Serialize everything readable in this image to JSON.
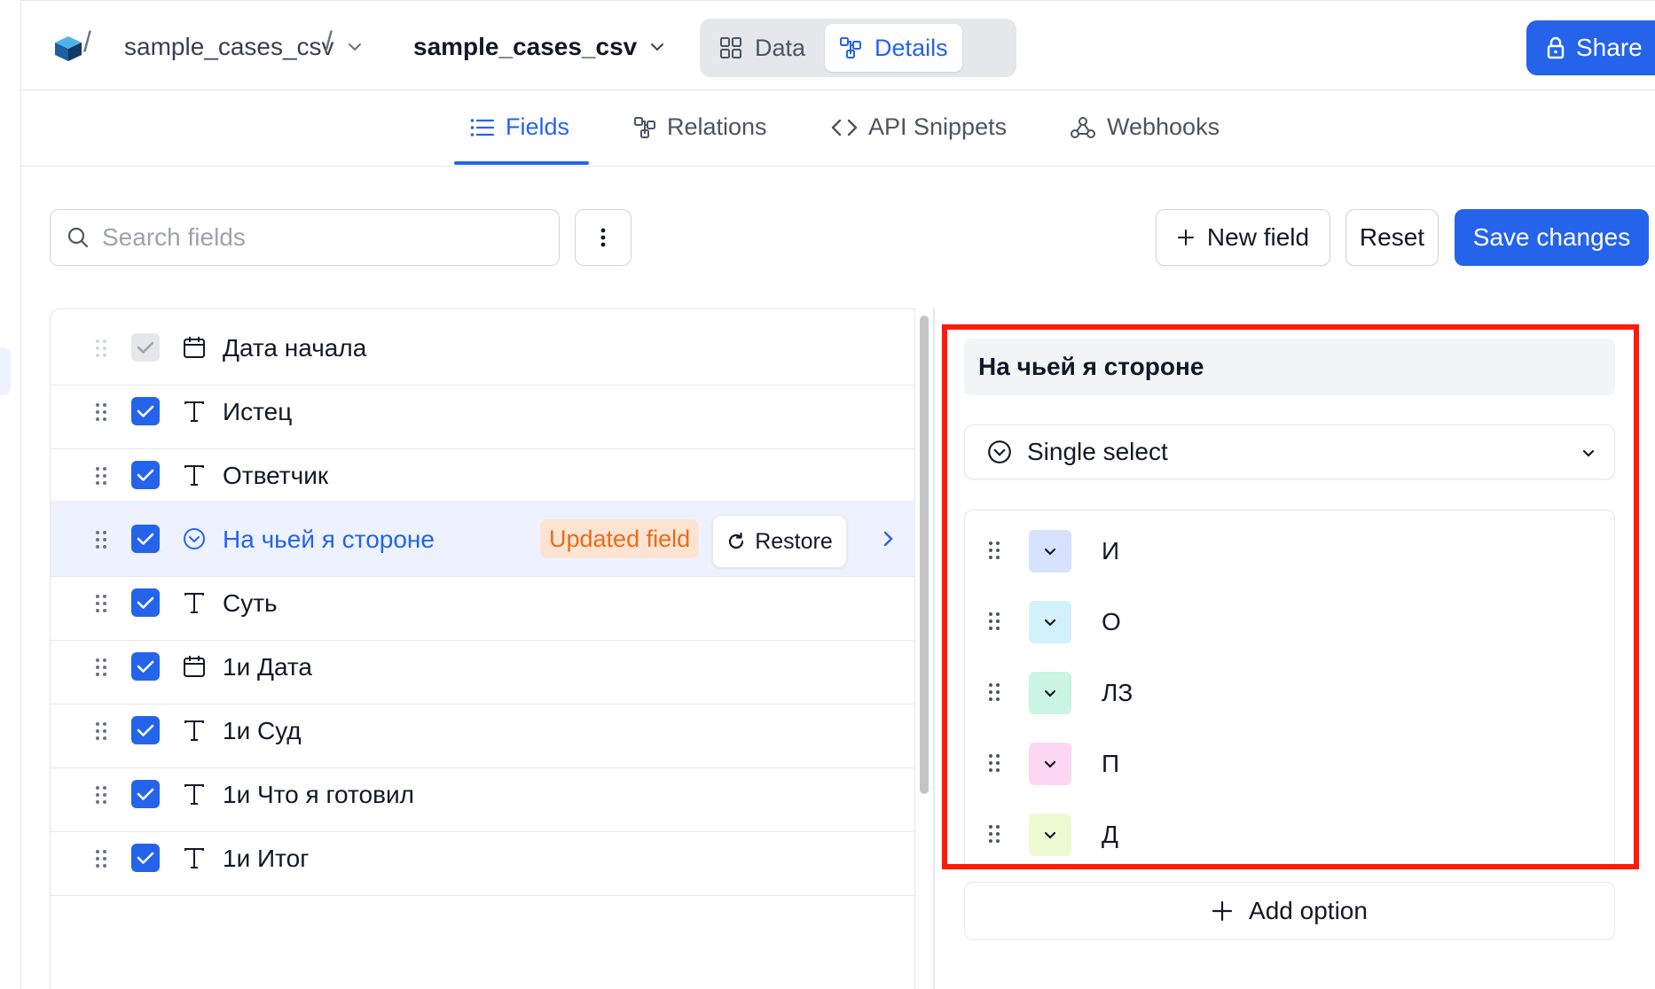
{
  "breadcrumb": {
    "base": "sample_cases_csv",
    "table": "sample_cases_csv"
  },
  "view_switch": {
    "data_label": "Data",
    "details_label": "Details",
    "active": "Details"
  },
  "share_label": "Share",
  "tabs": [
    {
      "label": "Fields",
      "icon": "list-icon",
      "active": true
    },
    {
      "label": "Relations",
      "icon": "relations-icon",
      "active": false
    },
    {
      "label": "API Snippets",
      "icon": "code-icon",
      "active": false
    },
    {
      "label": "Webhooks",
      "icon": "webhook-icon",
      "active": false
    }
  ],
  "toolbar": {
    "search_placeholder": "Search fields",
    "search_value": "",
    "new_field_label": "New field",
    "reset_label": "Reset",
    "save_label": "Save changes"
  },
  "fields": [
    {
      "name": "Дата начала",
      "type": "date",
      "checked": true,
      "locked": true
    },
    {
      "name": "Истец",
      "type": "text",
      "checked": true
    },
    {
      "name": "Ответчик",
      "type": "text",
      "checked": true
    },
    {
      "name": "На чьей я стороне",
      "type": "single-select",
      "checked": true,
      "selected": true,
      "badge": "Updated field",
      "restore_label": "Restore"
    },
    {
      "name": "Суть",
      "type": "text",
      "checked": true
    },
    {
      "name": "1и Дата",
      "type": "date",
      "checked": true
    },
    {
      "name": "1и Суд",
      "type": "text",
      "checked": true
    },
    {
      "name": "1и Что я готовил",
      "type": "text",
      "checked": true
    },
    {
      "name": "1и Итог",
      "type": "text",
      "checked": true
    }
  ],
  "detail": {
    "field_name": "На чьей я стороне",
    "field_type": "Single select",
    "options": [
      {
        "label": "И",
        "color": "#d6e2ff"
      },
      {
        "label": "О",
        "color": "#d2f1fb"
      },
      {
        "label": "ЛЗ",
        "color": "#caf5e4"
      },
      {
        "label": "П",
        "color": "#fcd7f3"
      },
      {
        "label": "Д",
        "color": "#eefad2"
      }
    ],
    "add_option_label": "Add option"
  },
  "colors": {
    "accent": "#2563eb",
    "highlight": "#ff1a0a",
    "badge_bg": "#fde4d2",
    "badge_text": "#ea6b1a"
  }
}
